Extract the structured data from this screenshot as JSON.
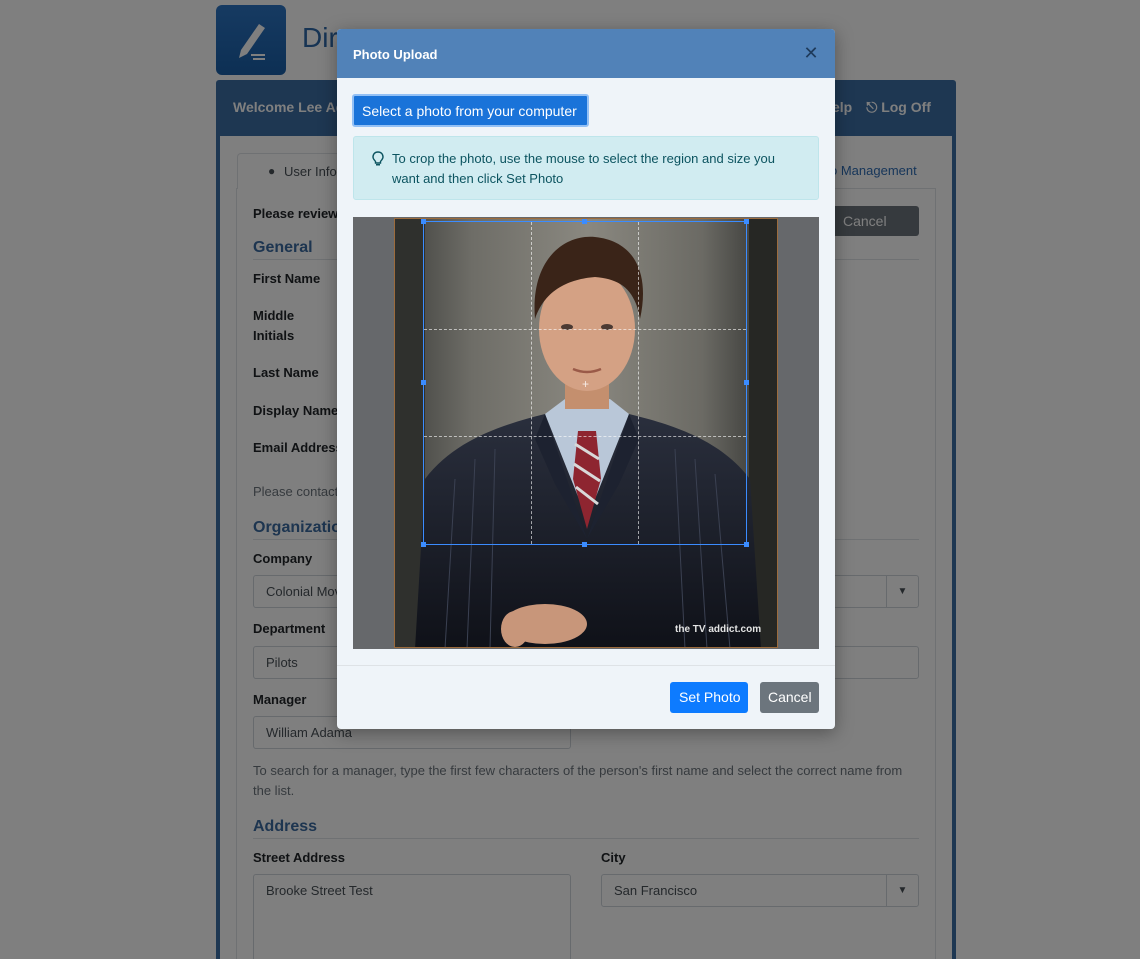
{
  "app": {
    "title": "Dire",
    "welcome": "Welcome Lee Ada",
    "help_link": "elp",
    "logoff_link": "Log Off"
  },
  "tabs": {
    "active_label": "User Infor",
    "other_label": "o Management"
  },
  "form": {
    "review_text": "Please review",
    "cancel_label": "Cancel",
    "sections": {
      "general": "General",
      "organization": "Organization",
      "address": "Address"
    },
    "labels": {
      "first_name": "First Name",
      "middle_1": "Middle",
      "middle_2": "Initials",
      "last_name": "Last Name",
      "display_name": "Display Name",
      "email": "Email Address",
      "company": "Company",
      "department": "Department",
      "manager": "Manager",
      "street": "Street Address",
      "city": "City"
    },
    "contact_text": "Please contact",
    "values": {
      "company": "Colonial Mov",
      "department": "Pilots",
      "manager": "William Adama",
      "street": "Brooke Street Test",
      "city": "San Francisco"
    },
    "manager_help_1": "To search for a manager, type the first few characters of the person's first name and select the correct name from",
    "manager_help_2": "the list."
  },
  "modal": {
    "title": "Photo Upload",
    "select_button": "Select a photo from your computer",
    "info_text": "To crop the photo, use the mouse to select the region and size you want and then click Set Photo",
    "set_photo_button": "Set Photo",
    "cancel_button": "Cancel",
    "watermark": "the TV addict.com"
  }
}
